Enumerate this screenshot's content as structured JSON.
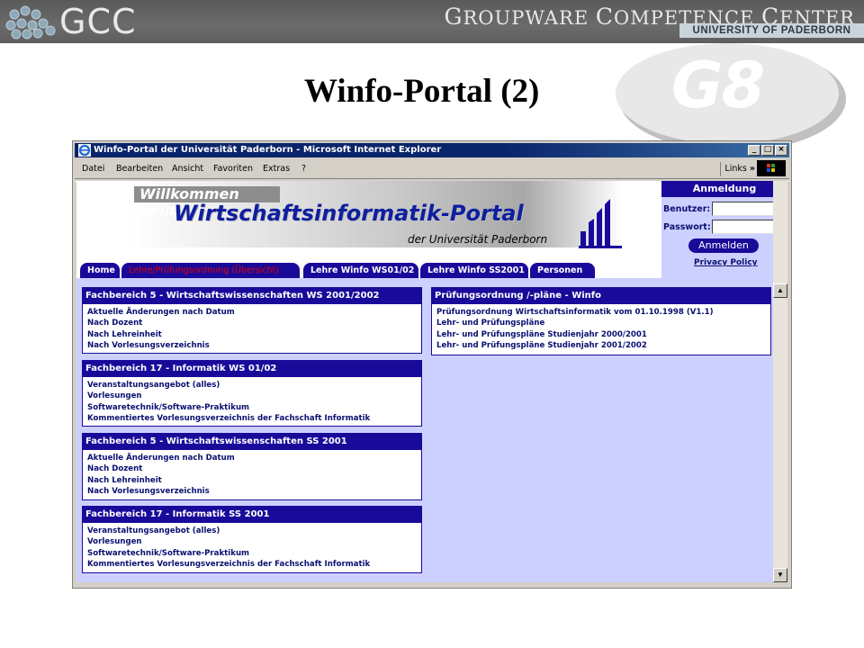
{
  "slide": {
    "logo_text": "GCC",
    "header_title_parts": [
      "G",
      "ROUPWARE ",
      "C",
      "OMPETENCE ",
      "C",
      "ENTER"
    ],
    "header_subtitle": "UNIVERSITY OF PADERBORN",
    "title": "Winfo-Portal (2)",
    "badge": "G8"
  },
  "browser": {
    "window_title": "Winfo-Portal der Universität Paderborn - Microsoft Internet Explorer",
    "menu": [
      "Datei",
      "Bearbeiten",
      "Ansicht",
      "Favoriten",
      "Extras",
      "?"
    ],
    "links_label": "Links",
    "links_chevron": "»",
    "controls": {
      "minimize": "_",
      "maximize": "□",
      "close": "×"
    },
    "scroll_up": "▲",
    "scroll_down": "▼"
  },
  "page": {
    "welcome": "Willkommen beim",
    "portal_title": "Wirtschaftsinformatik-Portal",
    "university": "der Universität Paderborn",
    "tabs": [
      "Home",
      "Lehre/Prüfungsordnung (Übersicht)",
      "Lehre Winfo WS01/02",
      "Lehre Winfo SS2001",
      "Personen"
    ],
    "active_tab": "Lehre/Prüfungsordnung (Übersicht)",
    "login": {
      "heading": "Anmeldung",
      "user_label": "Benutzer:",
      "password_label": "Passwort:",
      "button": "Anmelden",
      "privacy": "Privacy Policy"
    }
  },
  "boxes": [
    {
      "title": "Fachbereich 5 - Wirtschaftswissenschaften WS 2001/2002",
      "links": [
        "Aktuelle Änderungen nach Datum",
        "Nach Dozent",
        "Nach Lehreinheit",
        "Nach Vorlesungsverzeichnis"
      ]
    },
    {
      "title": "Fachbereich 17 - Informatik WS 01/02",
      "links": [
        "Veranstaltungsangebot (alles)",
        "Vorlesungen",
        "Softwaretechnik/Software-Praktikum",
        "Kommentiertes Vorlesungsverzeichnis der Fachschaft Informatik"
      ]
    },
    {
      "title": "Fachbereich 5 - Wirtschaftswissenschaften SS 2001",
      "links": [
        "Aktuelle Änderungen nach Datum",
        "Nach Dozent",
        "Nach Lehreinheit",
        "Nach Vorlesungsverzeichnis"
      ]
    },
    {
      "title": "Fachbereich 17 - Informatik SS 2001",
      "links": [
        "Veranstaltungsangebot (alles)",
        "Vorlesungen",
        "Softwaretechnik/Software-Praktikum",
        "Kommentiertes Vorlesungsverzeichnis der Fachschaft Informatik"
      ]
    },
    {
      "title": "Prüfungsordnung /-pläne - Winfo",
      "links": [
        "Prüfungsordnung Wirtschaftsinformatik vom 01.10.1998 (V1.1)",
        "Lehr- und Prüfungspläne",
        "Lehr- und Prüfungspläne Studienjahr 2000/2001",
        "Lehr- und Prüfungspläne Studienjahr 2001/2002"
      ]
    }
  ],
  "colors": {
    "nav_blue": "#1a0a9a",
    "page_background": "#ccd0ff",
    "active_tab_text": "#e00000",
    "portal_title": "#0f1f9e"
  }
}
